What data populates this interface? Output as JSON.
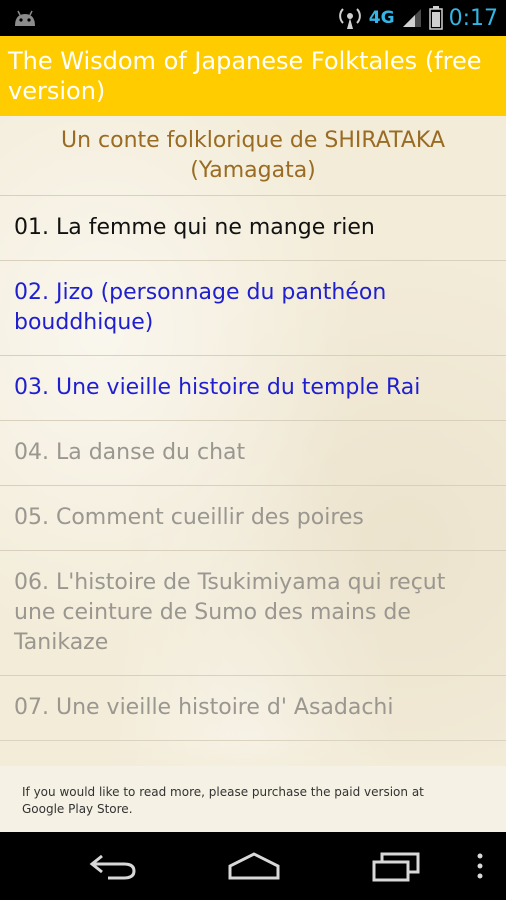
{
  "status_bar": {
    "network": "4G",
    "time": "0:17",
    "icons": [
      "android-icon",
      "signal-broadcast-icon",
      "signal-strength-icon",
      "battery-icon"
    ]
  },
  "app_bar": {
    "title": "The Wisdom of Japanese Folktales (free version)",
    "background": "#ffcc00"
  },
  "header": {
    "line1": "Un conte folklorique de SHIRATAKA",
    "line2": "(Yamagata)"
  },
  "stories": [
    {
      "lines": [
        "01. La femme qui ne mange rien"
      ],
      "state": "normal"
    },
    {
      "lines": [
        "02. Jizo (personnage du panthéon",
        "bouddhique)"
      ],
      "state": "link"
    },
    {
      "lines": [
        "03. Une vieille histoire du temple Rai"
      ],
      "state": "link"
    },
    {
      "lines": [
        "04. La danse du chat"
      ],
      "state": "locked"
    },
    {
      "lines": [
        "05. Comment cueillir des poires"
      ],
      "state": "locked"
    },
    {
      "lines": [
        "06. L'histoire de Tsukimiyama qui reçut",
        "une ceinture de Sumo des mains de",
        "Tanikaze"
      ],
      "state": "locked"
    },
    {
      "lines": [
        "07. Une vieille histoire d' Asadachi"
      ],
      "state": "locked"
    }
  ],
  "footer": {
    "line1": "If you would like to read more, please purchase the paid version at",
    "line2": "Google Play Store."
  },
  "nav_bar": {
    "icons": [
      "back-icon",
      "home-icon",
      "recent-apps-icon",
      "menu-icon"
    ]
  }
}
